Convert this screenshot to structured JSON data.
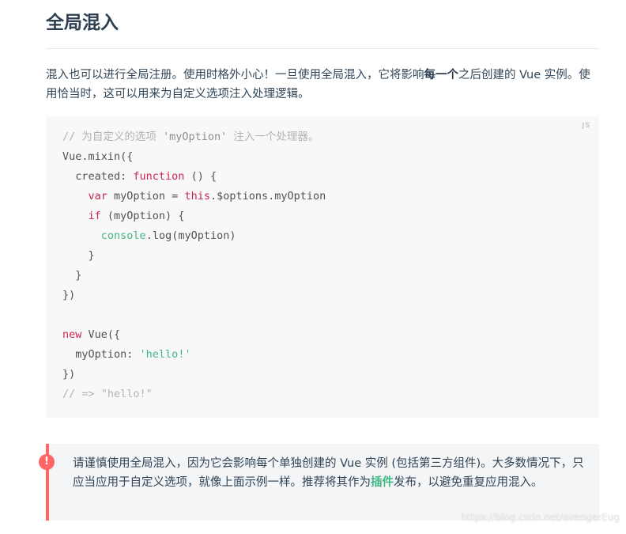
{
  "section": {
    "title": "全局混入"
  },
  "intro": {
    "part1": "混入也可以进行全局注册。使用时格外小心！一旦使用全局混入，它将影响",
    "bold": "每一个",
    "part2": "之后创建的 Vue 实例。使用恰当时，这可以用来为自定义选项注入处理逻辑。"
  },
  "code": {
    "language": "JS",
    "line1_comment_a": "// 为自定义的选项 ",
    "line1_comment_ident": "'myOption'",
    "line1_comment_b": " 注入一个处理器。",
    "line2": "Vue.mixin({",
    "line3_a": "  created: ",
    "line3_kw": "function",
    "line3_b": " () {",
    "line4_indent": "    ",
    "line4_kw": "var",
    "line4_a": " myOption = ",
    "line4_this": "this",
    "line4_b": ".$options.myOption",
    "line5_indent": "    ",
    "line5_kw": "if",
    "line5_a": " (myOption) {",
    "line6_indent": "      ",
    "line6_builtin": "console",
    "line6_a": ".log(myOption)",
    "line7": "    }",
    "line8": "  }",
    "line9": "})",
    "line10": "",
    "line11_kw": "new",
    "line11_a": " Vue({",
    "line12_a": "  myOption: ",
    "line12_str": "'hello!'",
    "line13": "})",
    "line14": "// => \"hello!\""
  },
  "tip": {
    "icon": "!",
    "part1": "请谨慎使用全局混入，因为它会影响每个单独创建的 Vue 实例 (包括第三方组件)。大多数情况下，只应当应用于自定义选项，就像上面示例一样。推荐将其作为",
    "link": "插件",
    "part2": "发布，以避免重复应用混入。"
  },
  "watermark": "https://blog.csdn.net/avengerEug"
}
